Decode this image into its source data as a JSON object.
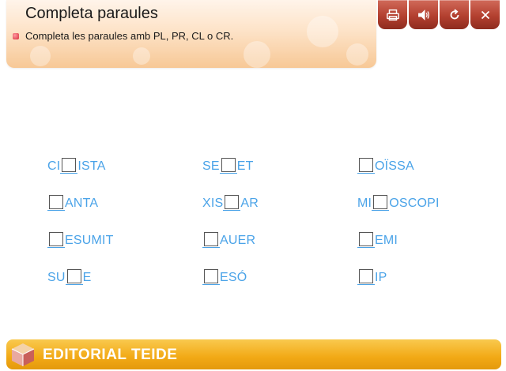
{
  "header": {
    "title": "Completa paraules",
    "instruction": "Completa les paraules amb PL, PR, CL o CR."
  },
  "toolbar": {
    "buttons": [
      {
        "icon": "print-icon"
      },
      {
        "icon": "audio-icon"
      },
      {
        "icon": "reload-icon"
      },
      {
        "icon": "close-icon"
      }
    ]
  },
  "exercise": {
    "items": [
      {
        "before": "CI",
        "after": "ISTA"
      },
      {
        "before": "SE",
        "after": "ET"
      },
      {
        "before": "",
        "after": "OÏSSA"
      },
      {
        "before": "",
        "after": "ANTA"
      },
      {
        "before": "XIS",
        "after": "AR"
      },
      {
        "before": "MI",
        "after": "OSCOPI"
      },
      {
        "before": "",
        "after": "ESUMIT"
      },
      {
        "before": "",
        "after": "AUER"
      },
      {
        "before": "",
        "after": "EMI"
      },
      {
        "before": "SU",
        "after": "E"
      },
      {
        "before": "",
        "after": "ESÓ"
      },
      {
        "before": "",
        "after": "IP"
      }
    ],
    "answers": [
      "",
      "",
      "",
      "",
      "",
      "",
      "",
      "",
      "",
      "",
      "",
      ""
    ]
  },
  "footer": {
    "brand": "EDITORIAL TEIDE"
  },
  "colors": {
    "word_blue": "#4aa3e8",
    "button_red": "#b3402f",
    "footer_orange": "#f2a915"
  }
}
